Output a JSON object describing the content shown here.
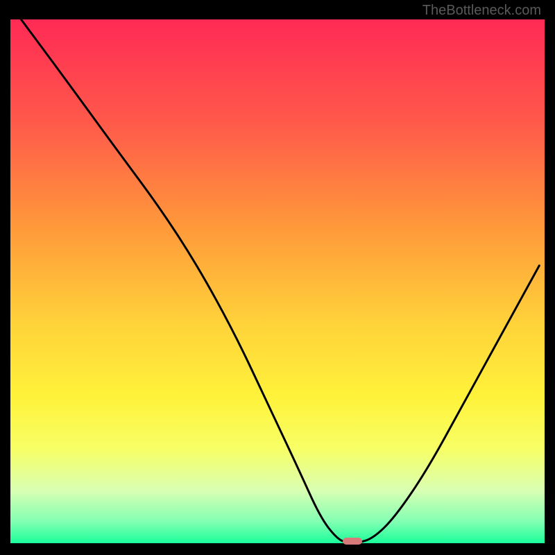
{
  "watermark": "TheBottleneck.com",
  "chart_data": {
    "type": "line",
    "title": "",
    "xlabel": "",
    "ylabel": "",
    "xlim": [
      0,
      100
    ],
    "ylim": [
      0,
      100
    ],
    "series": [
      {
        "name": "bottleneck-curve",
        "x": [
          2,
          10,
          20,
          28,
          35,
          42,
          48,
          54,
          58,
          61,
          63,
          65,
          68,
          72,
          78,
          85,
          92,
          99
        ],
        "y": [
          100,
          89,
          75,
          64,
          53,
          40,
          27,
          14,
          5,
          1,
          0,
          0,
          1,
          5,
          14,
          27,
          40,
          53
        ],
        "color": "#000000"
      }
    ],
    "marker": {
      "x": 64,
      "y": 0,
      "color": "#d97a7a"
    },
    "background_gradient": {
      "type": "vertical",
      "stops": [
        {
          "pos": 0.0,
          "color": "#ff2a55"
        },
        {
          "pos": 0.2,
          "color": "#ff5a4a"
        },
        {
          "pos": 0.4,
          "color": "#ff9a3a"
        },
        {
          "pos": 0.58,
          "color": "#ffd23a"
        },
        {
          "pos": 0.72,
          "color": "#fff23a"
        },
        {
          "pos": 0.82,
          "color": "#f7ff66"
        },
        {
          "pos": 0.9,
          "color": "#d9ffb3"
        },
        {
          "pos": 0.96,
          "color": "#7fffb3"
        },
        {
          "pos": 1.0,
          "color": "#1aff9a"
        }
      ]
    }
  }
}
